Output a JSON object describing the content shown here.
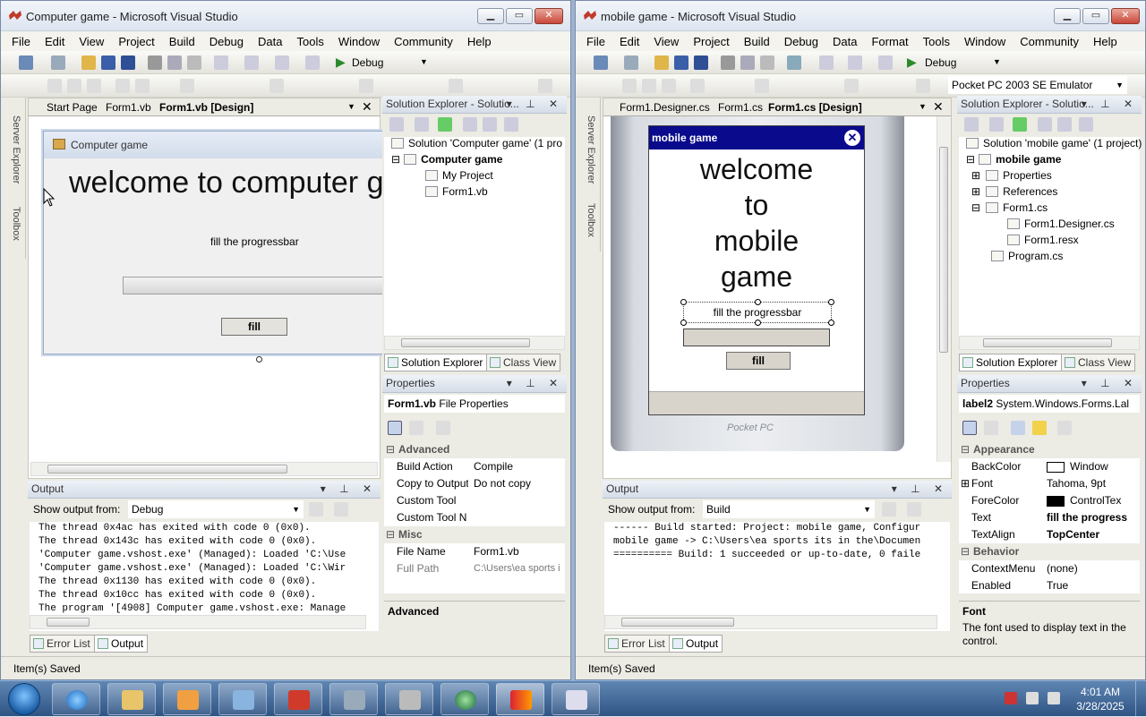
{
  "left": {
    "title": "Computer game - Microsoft Visual Studio",
    "menu": [
      "File",
      "Edit",
      "View",
      "Project",
      "Build",
      "Debug",
      "Data",
      "Tools",
      "Window",
      "Community",
      "Help"
    ],
    "config": "Debug",
    "sidebar": [
      "Server Explorer",
      "Toolbox"
    ],
    "doc_tabs": [
      "Start Page",
      "Form1.vb",
      "Form1.vb [Design]"
    ],
    "form": {
      "title": "Computer game",
      "heading": "welcome to computer g",
      "label": "fill the progressbar",
      "button": "fill"
    },
    "solution": {
      "header": "Solution Explorer - Solutio...",
      "items": [
        "Solution 'Computer game' (1 pro",
        "Computer game",
        "My Project",
        "Form1.vb"
      ],
      "tabs": [
        "Solution Explorer",
        "Class View"
      ]
    },
    "properties": {
      "header": "Properties",
      "object": "Form1.vb",
      "object_type": "File Properties",
      "rows": [
        {
          "cat": "Advanced"
        },
        {
          "k": "Build Action",
          "v": "Compile"
        },
        {
          "k": "Copy to Output",
          "v": "Do not copy"
        },
        {
          "k": "Custom Tool",
          "v": ""
        },
        {
          "k": "Custom Tool N",
          "v": ""
        },
        {
          "cat": "Misc"
        },
        {
          "k": "File Name",
          "v": "Form1.vb"
        },
        {
          "k": "Full Path",
          "v": "C:\\Users\\ea sports i"
        }
      ],
      "desc_title": "Advanced"
    },
    "output": {
      "header": "Output",
      "from_label": "Show output from:",
      "from_value": "Debug",
      "lines": [
        "The thread 0x4ac has exited with code 0 (0x0).",
        "The thread 0x143c has exited with code 0 (0x0).",
        "'Computer game.vshost.exe' (Managed): Loaded 'C:\\Use",
        "'Computer game.vshost.exe' (Managed): Loaded 'C:\\Wir",
        "The thread 0x1130 has exited with code 0 (0x0).",
        "The thread 0x10cc has exited with code 0 (0x0).",
        "The program '[4908] Computer game.vshost.exe: Manage"
      ],
      "tabs": [
        "Error List",
        "Output"
      ]
    },
    "status": "Item(s) Saved"
  },
  "right": {
    "title": "mobile game - Microsoft Visual Studio",
    "menu": [
      "File",
      "Edit",
      "View",
      "Project",
      "Build",
      "Debug",
      "Data",
      "Format",
      "Tools",
      "Window",
      "Community",
      "Help"
    ],
    "config": "Debug",
    "device": "Pocket PC 2003 SE Emulator",
    "sidebar": [
      "Server Explorer",
      "Toolbox"
    ],
    "doc_tabs": [
      "Form1.Designer.cs",
      "Form1.cs",
      "Form1.cs [Design]"
    ],
    "form": {
      "title": "mobile game",
      "heading": [
        "welcome",
        "to",
        "mobile",
        "game"
      ],
      "label": "fill the progressbar",
      "button": "fill",
      "brand": "Pocket PC"
    },
    "solution": {
      "header": "Solution Explorer - Solutio...",
      "items": [
        "Solution 'mobile game' (1 project)",
        "mobile game",
        "Properties",
        "References",
        "Form1.cs",
        "Form1.Designer.cs",
        "Form1.resx",
        "Program.cs"
      ],
      "tabs": [
        "Solution Explorer",
        "Class View"
      ]
    },
    "properties": {
      "header": "Properties",
      "object": "label2",
      "object_type": "System.Windows.Forms.Lal",
      "rows": [
        {
          "cat": "Appearance"
        },
        {
          "k": "BackColor",
          "v": "Window",
          "swatch": "#ffffff"
        },
        {
          "k": "Font",
          "v": "Tahoma, 9pt"
        },
        {
          "k": "ForeColor",
          "v": "ControlTex",
          "swatch": "#000000"
        },
        {
          "k": "Text",
          "v": "fill the progress",
          "bold": true
        },
        {
          "k": "TextAlign",
          "v": "TopCenter",
          "bold": true
        },
        {
          "cat": "Behavior"
        },
        {
          "k": "ContextMenu",
          "v": "(none)"
        },
        {
          "k": "Enabled",
          "v": "True"
        }
      ],
      "desc_title": "Font",
      "desc_text": "The font used to display text in the control."
    },
    "output": {
      "header": "Output",
      "from_label": "Show output from:",
      "from_value": "Build",
      "lines": [
        "------ Build started: Project: mobile game, Configur",
        "mobile game -> C:\\Users\\ea sports its in the\\Documen",
        "========== Build: 1 succeeded or up-to-date, 0 faile"
      ],
      "tabs": [
        "Error List",
        "Output"
      ]
    },
    "status": "Item(s) Saved"
  },
  "tray": {
    "time": "4:01 AM",
    "date": "3/28/2025"
  },
  "colors": {
    "accent": "#0a0a8c",
    "taskbar": "#3c6196"
  }
}
